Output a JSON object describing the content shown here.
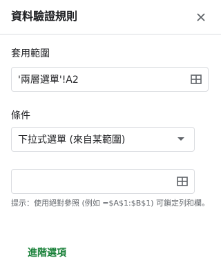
{
  "header": {
    "title": "資料驗證規則",
    "close_icon": "close-icon"
  },
  "apply_range": {
    "label": "套用範圍",
    "value": "'兩層選單'!A2",
    "icon": "select-range-icon"
  },
  "criteria": {
    "label": "條件",
    "selected": "下拉式選單 (來自某範圍)",
    "value_input": "",
    "value_icon": "select-range-icon",
    "hint": "提示：使用絕對參照 (例如 =$A$1:$B$1) 可鎖定列和欄。"
  },
  "footer": {
    "advanced_label": "進階選項"
  },
  "colors": {
    "accent": "#188038",
    "border": "#dadce0",
    "icon": "#5f6368"
  }
}
